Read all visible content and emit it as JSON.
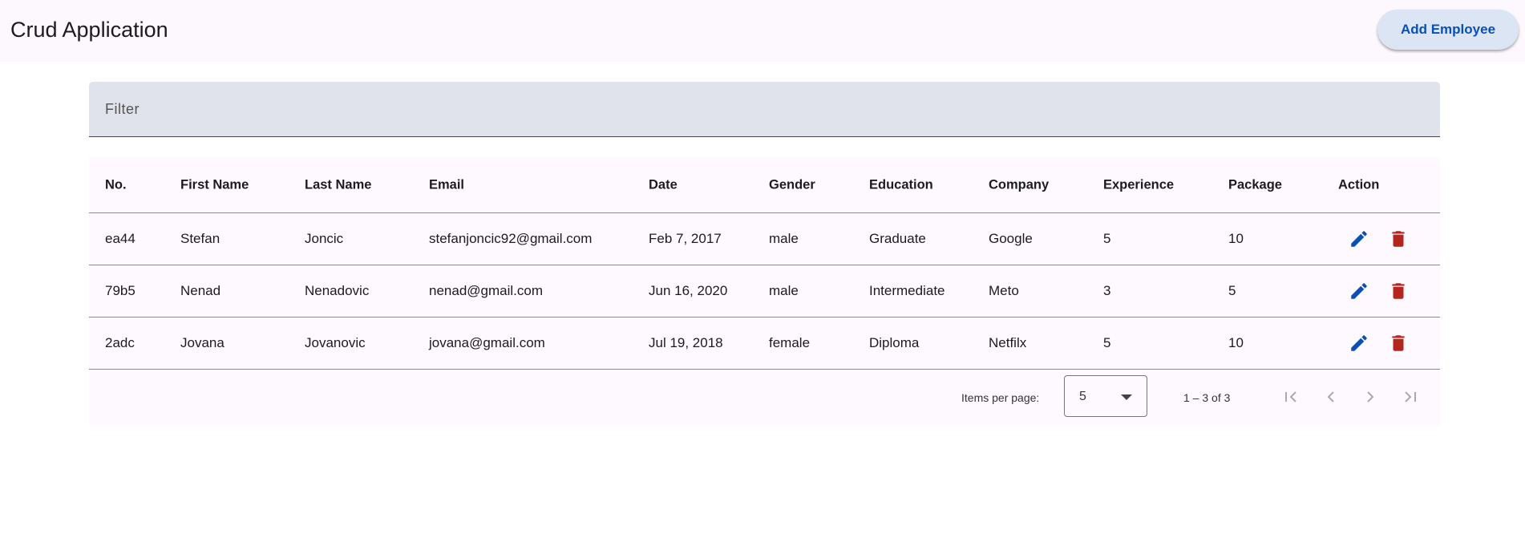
{
  "app": {
    "title": "Crud Application",
    "add_button": "Add Employee"
  },
  "filter": {
    "placeholder": "Filter"
  },
  "table": {
    "headers": [
      "No.",
      "First Name",
      "Last Name",
      "Email",
      "Date",
      "Gender",
      "Education",
      "Company",
      "Experience",
      "Package",
      "Action"
    ],
    "rows": [
      [
        "ea44",
        "Stefan",
        "Joncic",
        "stefanjoncic92@gmail.com",
        "Feb 7, 2017",
        "male",
        "Graduate",
        "Google",
        "5",
        "10"
      ],
      [
        "79b5",
        "Nenad",
        "Nenadovic",
        "nenad@gmail.com",
        "Jun 16, 2020",
        "male",
        "Intermediate",
        "Meto",
        "3",
        "5"
      ],
      [
        "2adc",
        "Jovana",
        "Jovanovic",
        "jovana@gmail.com",
        "Jul 19, 2018",
        "female",
        "Diploma",
        "Netfilx",
        "5",
        "10"
      ]
    ]
  },
  "paginator": {
    "items_label": "Items per page:",
    "page_size": "5",
    "range": "1 – 3 of 3"
  },
  "colors": {
    "edit": "#0a4fb5",
    "delete": "#b3261e"
  }
}
